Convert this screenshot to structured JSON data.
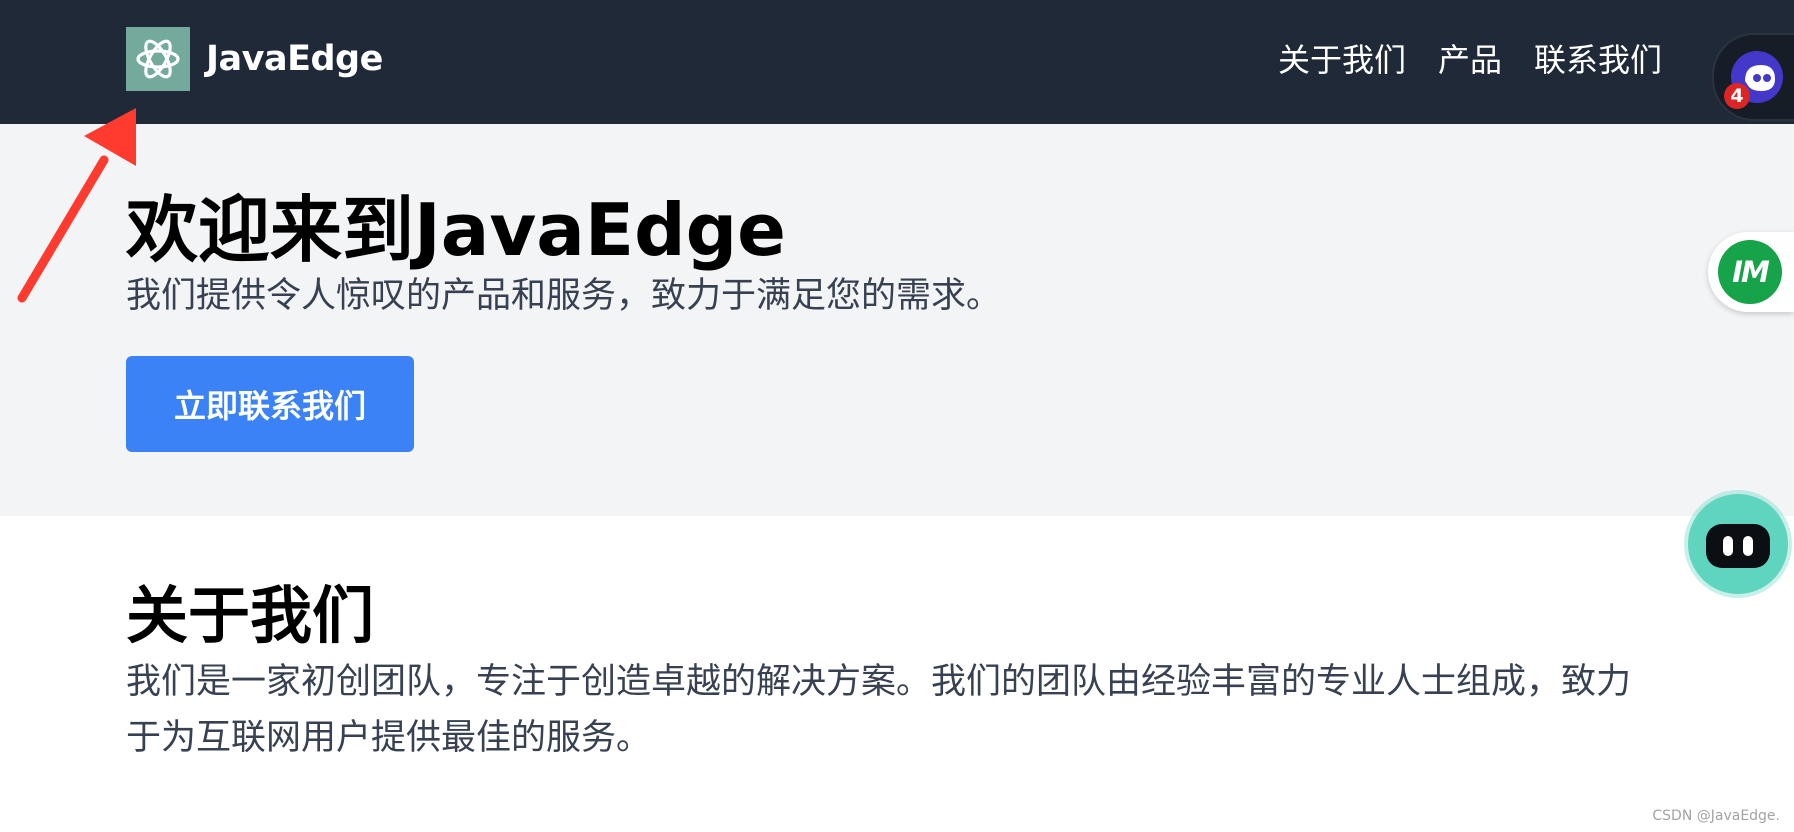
{
  "header": {
    "brand": "JavaEdge",
    "nav": {
      "about": "关于我们",
      "products": "产品",
      "contact": "联系我们"
    }
  },
  "hero": {
    "title": "欢迎来到JavaEdge",
    "subtitle": "我们提供令人惊叹的产品和服务，致力于满足您的需求。",
    "button": "立即联系我们"
  },
  "about": {
    "title": "关于我们",
    "text": "我们是一家初创团队，专注于创造卓越的解决方案。我们的团队由经验丰富的专业人士组成，致力于为互联网用户提供最佳的服务。"
  },
  "floating": {
    "chat_badge_count": "4",
    "im_label": "IM"
  },
  "watermark": "CSDN @JavaEdge.",
  "icons": {
    "logo": "openai-knot-icon",
    "chat": "chat-avatar-icon",
    "im": "im-icon",
    "bot": "robot-icon"
  },
  "colors": {
    "header_bg": "#1f2937",
    "hero_bg": "#f3f4f6",
    "button_bg": "#3b82f6",
    "logo_bg": "#74aa9c",
    "annotation": "#ff3b30"
  }
}
